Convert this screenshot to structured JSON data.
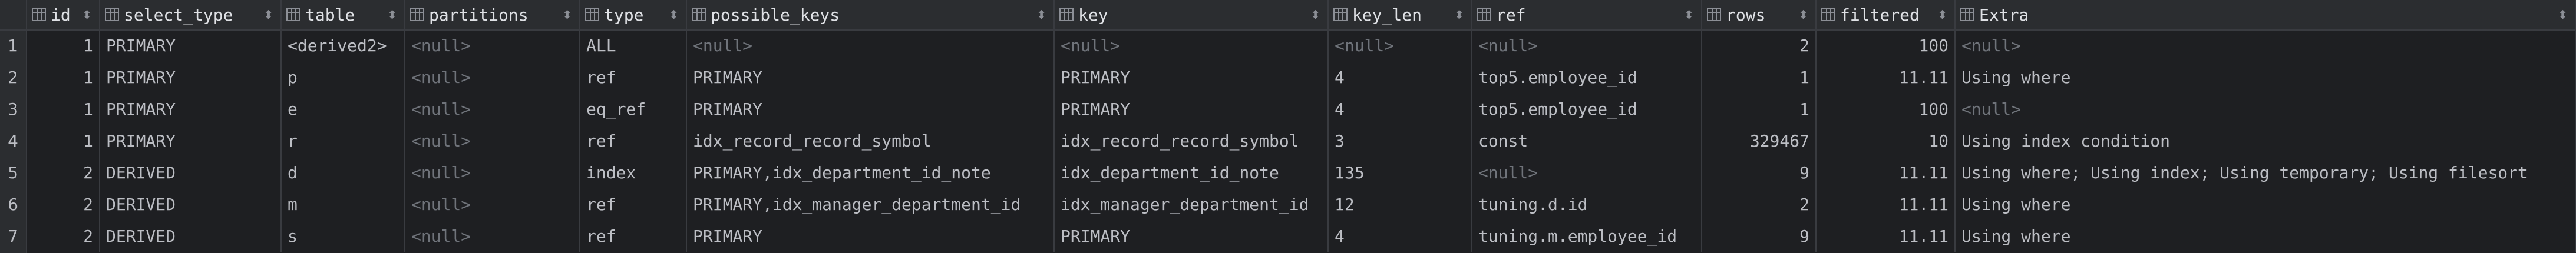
{
  "columns": [
    {
      "key": "id",
      "label": "id",
      "align": "right"
    },
    {
      "key": "select_type",
      "label": "select_type",
      "align": "left"
    },
    {
      "key": "table",
      "label": "table",
      "align": "left"
    },
    {
      "key": "partitions",
      "label": "partitions",
      "align": "left"
    },
    {
      "key": "type",
      "label": "type",
      "align": "left"
    },
    {
      "key": "possible_keys",
      "label": "possible_keys",
      "align": "left"
    },
    {
      "key": "key",
      "label": "key",
      "align": "left"
    },
    {
      "key": "key_len",
      "label": "key_len",
      "align": "left"
    },
    {
      "key": "ref",
      "label": "ref",
      "align": "left"
    },
    {
      "key": "rows",
      "label": "rows",
      "align": "right"
    },
    {
      "key": "filtered",
      "label": "filtered",
      "align": "right"
    },
    {
      "key": "extra",
      "label": "Extra",
      "align": "left"
    }
  ],
  "row_numbers": [
    "1",
    "2",
    "3",
    "4",
    "5",
    "6",
    "7"
  ],
  "null_text": "<null>",
  "rows": [
    {
      "id": "1",
      "select_type": "PRIMARY",
      "table": "<derived2>",
      "partitions": "<null>",
      "type": "ALL",
      "possible_keys": "<null>",
      "key": "<null>",
      "key_len": "<null>",
      "ref": "<null>",
      "rows": "2",
      "filtered": "100",
      "extra": "<null>"
    },
    {
      "id": "1",
      "select_type": "PRIMARY",
      "table": "p",
      "partitions": "<null>",
      "type": "ref",
      "possible_keys": "PRIMARY",
      "key": "PRIMARY",
      "key_len": "4",
      "ref": "top5.employee_id",
      "rows": "1",
      "filtered": "11.11",
      "extra": "Using where"
    },
    {
      "id": "1",
      "select_type": "PRIMARY",
      "table": "e",
      "partitions": "<null>",
      "type": "eq_ref",
      "possible_keys": "PRIMARY",
      "key": "PRIMARY",
      "key_len": "4",
      "ref": "top5.employee_id",
      "rows": "1",
      "filtered": "100",
      "extra": "<null>"
    },
    {
      "id": "1",
      "select_type": "PRIMARY",
      "table": "r",
      "partitions": "<null>",
      "type": "ref",
      "possible_keys": "idx_record_record_symbol",
      "key": "idx_record_record_symbol",
      "key_len": "3",
      "ref": "const",
      "rows": "329467",
      "filtered": "10",
      "extra": "Using index condition"
    },
    {
      "id": "2",
      "select_type": "DERIVED",
      "table": "d",
      "partitions": "<null>",
      "type": "index",
      "possible_keys": "PRIMARY,idx_department_id_note",
      "key": "idx_department_id_note",
      "key_len": "135",
      "ref": "<null>",
      "rows": "9",
      "filtered": "11.11",
      "extra": "Using where; Using index; Using temporary; Using filesort"
    },
    {
      "id": "2",
      "select_type": "DERIVED",
      "table": "m",
      "partitions": "<null>",
      "type": "ref",
      "possible_keys": "PRIMARY,idx_manager_department_id",
      "key": "idx_manager_department_id",
      "key_len": "12",
      "ref": "tuning.d.id",
      "rows": "2",
      "filtered": "11.11",
      "extra": "Using where"
    },
    {
      "id": "2",
      "select_type": "DERIVED",
      "table": "s",
      "partitions": "<null>",
      "type": "ref",
      "possible_keys": "PRIMARY",
      "key": "PRIMARY",
      "key_len": "4",
      "ref": "tuning.m.employee_id",
      "rows": "9",
      "filtered": "11.11",
      "extra": "Using where"
    }
  ],
  "colors": {
    "background": "#1e1f22",
    "header_bg": "#2b2d30",
    "text": "#bcbec4",
    "null_text": "#6f737a",
    "grid_line": "#393b40"
  }
}
